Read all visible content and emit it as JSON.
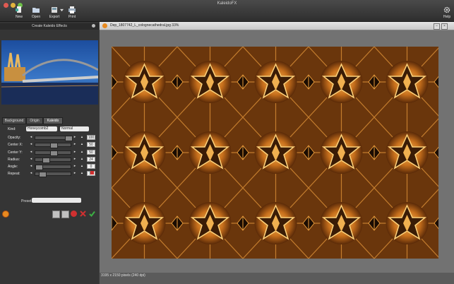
{
  "app": {
    "title": "KaleidoFX"
  },
  "toolbar": {
    "new_label": "New",
    "open_label": "Open",
    "export_label": "Export",
    "print_label": "Print",
    "help_label": "Help"
  },
  "left_panel": {
    "header": "Create Kaleido Effects",
    "tabs": [
      {
        "label": "Background"
      },
      {
        "label": "Origin"
      },
      {
        "label": "Kaleido"
      }
    ],
    "active_tab": "Kaleido",
    "kind": {
      "label": "Kind:",
      "value": "Honeycomb2",
      "mode": "Normal"
    },
    "params": [
      {
        "label": "Opacity:",
        "value": "100",
        "level": 1.0
      },
      {
        "label": "Center X:",
        "value": "50",
        "level": 0.5
      },
      {
        "label": "Center Y:",
        "value": "50",
        "level": 0.5
      },
      {
        "label": "Radius:",
        "value": "24",
        "level": 0.24
      },
      {
        "label": "Angle:",
        "value": "0",
        "level": 0.0
      },
      {
        "label": "Repeat:",
        "value": "12",
        "level": 0.12
      }
    ],
    "preset": {
      "label": "Preset:",
      "value": ""
    }
  },
  "document": {
    "title": "Dep_1807742_L_colognecathedral.jpg 33%",
    "status": "3195 x 2150 pixels (240 dpi)"
  },
  "colors": {
    "accent": "#e8a030",
    "ok": "#3cb043",
    "cancel": "#d03030"
  }
}
